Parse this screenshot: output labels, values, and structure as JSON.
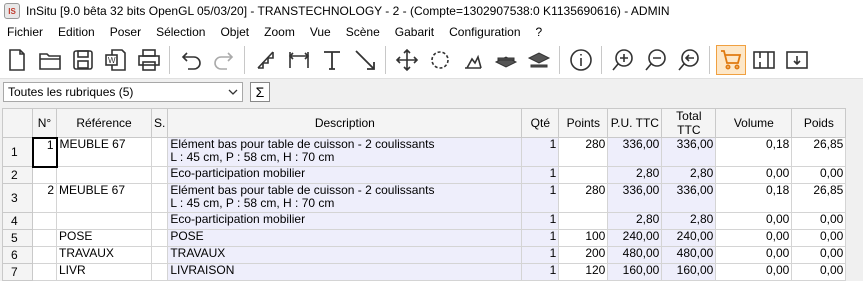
{
  "window": {
    "title": "InSitu [9.0 bêta 32 bits OpenGL 05/03/20] - TRANSTECHNOLOGY - 2 - (Compte=1302907538:0 K1135690616) - ADMIN",
    "icon_text": "IS"
  },
  "menu": [
    "Fichier",
    "Edition",
    "Poser",
    "Sélection",
    "Objet",
    "Zoom",
    "Vue",
    "Scène",
    "Gabarit",
    "Configuration",
    "?"
  ],
  "toolbar": {
    "icons": [
      "new-document-icon",
      "open-folder-icon",
      "save-icon",
      "word-export-icon",
      "print-icon",
      "undo-icon",
      "redo-icon",
      "stair-icon",
      "dimension-icon",
      "text-icon",
      "line-icon",
      "move-icon",
      "rotate-icon",
      "cut-paint-icon",
      "layer-up-icon",
      "layer-down-icon",
      "info-icon",
      "zoom-in-icon",
      "zoom-out-icon",
      "zoom-back-icon",
      "cart-icon",
      "frame-icon",
      "frame-arrow-icon"
    ],
    "accent": "#f0a040"
  },
  "filter": {
    "selected": "Toutes les rubriques (5)",
    "sum_symbol": "Σ"
  },
  "table": {
    "headers": [
      "N°",
      "Référence",
      "S.",
      "Description",
      "Qté",
      "Points",
      "P.U. TTC",
      "Total TTC",
      "Volume",
      "Poids"
    ],
    "rows": [
      {
        "row": "1",
        "n": "1",
        "ref": "MEUBLE 67",
        "s": "",
        "desc1": "Elément bas pour table de cuisson - 2 coulissants",
        "desc2": "L : 45 cm, P : 58 cm, H : 70 cm",
        "qte": "1",
        "points": "280",
        "pu": "336,00",
        "total": "336,00",
        "volume": "0,18",
        "poids": "26,85"
      },
      {
        "row": "2",
        "n": "",
        "ref": "",
        "s": "",
        "desc1": "Eco-participation mobilier",
        "desc2": "",
        "qte": "1",
        "points": "",
        "pu": "2,80",
        "total": "2,80",
        "volume": "0,00",
        "poids": "0,00"
      },
      {
        "row": "3",
        "n": "2",
        "ref": "MEUBLE 67",
        "s": "",
        "desc1": "Elément bas pour table de cuisson - 2 coulissants",
        "desc2": "L : 45 cm, P : 58 cm, H : 70 cm",
        "qte": "1",
        "points": "280",
        "pu": "336,00",
        "total": "336,00",
        "volume": "0,18",
        "poids": "26,85"
      },
      {
        "row": "4",
        "n": "",
        "ref": "",
        "s": "",
        "desc1": "Eco-participation mobilier",
        "desc2": "",
        "qte": "1",
        "points": "",
        "pu": "2,80",
        "total": "2,80",
        "volume": "0,00",
        "poids": "0,00"
      },
      {
        "row": "5",
        "n": "",
        "ref": "POSE",
        "s": "",
        "desc1": "POSE",
        "desc2": "",
        "qte": "1",
        "points": "100",
        "pu": "240,00",
        "total": "240,00",
        "volume": "0,00",
        "poids": "0,00"
      },
      {
        "row": "6",
        "n": "",
        "ref": "TRAVAUX",
        "s": "",
        "desc1": "TRAVAUX",
        "desc2": "",
        "qte": "1",
        "points": "200",
        "pu": "480,00",
        "total": "480,00",
        "volume": "0,00",
        "poids": "0,00"
      },
      {
        "row": "7",
        "n": "",
        "ref": "LIVR",
        "s": "",
        "desc1": "LIVRAISON",
        "desc2": "",
        "qte": "1",
        "points": "120",
        "pu": "160,00",
        "total": "160,00",
        "volume": "0,00",
        "poids": "0,00"
      }
    ]
  }
}
